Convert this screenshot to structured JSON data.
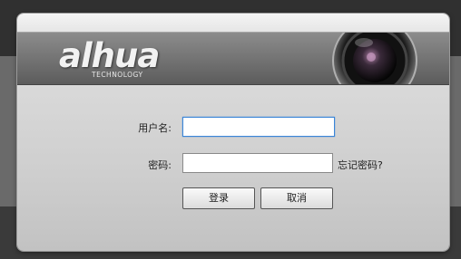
{
  "brand": {
    "logo_text": "alhua",
    "logo_subtext": "TECHNOLOGY"
  },
  "form": {
    "username_label": "用户名:",
    "username_value": "",
    "password_label": "密码:",
    "password_value": "",
    "forgot_password": "忘记密码?"
  },
  "actions": {
    "login_label": "登录",
    "cancel_label": "取消"
  },
  "colors": {
    "focus_border": "#3b86d8",
    "banner": "#6e6e6e",
    "panel": "#d4d4d4"
  },
  "icons": {
    "camera": "camera-lens-icon"
  }
}
